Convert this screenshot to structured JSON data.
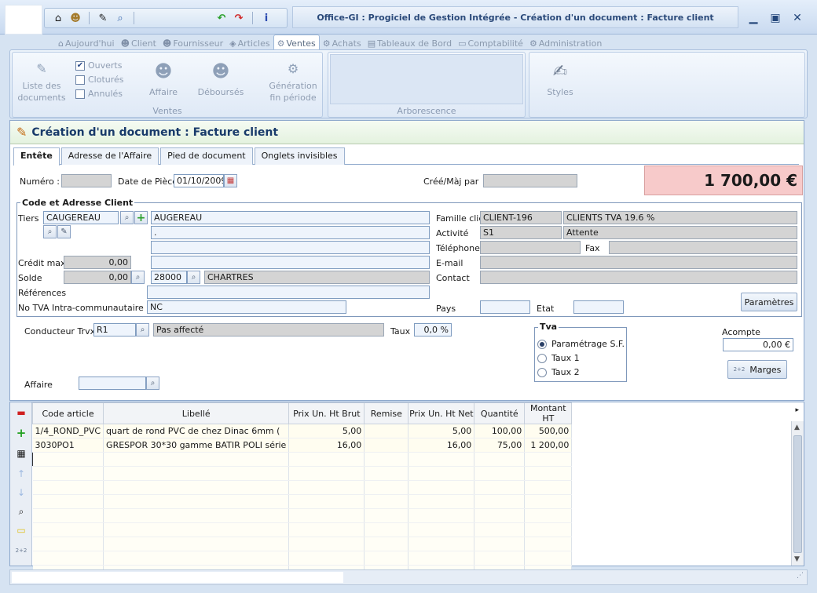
{
  "window": {
    "title": "Office-GI : Progiciel de Gestion Intégrée - Création d'un document : Facture client"
  },
  "ribbon_tabs": [
    {
      "label": "Aujourd'hui",
      "icon": "home-icon"
    },
    {
      "label": "Client",
      "icon": "person-icon"
    },
    {
      "label": "Fournisseur",
      "icon": "person-icon"
    },
    {
      "label": "Articles",
      "icon": "box-icon"
    },
    {
      "label": "Ventes",
      "icon": "gear-icon"
    },
    {
      "label": "Achats",
      "icon": "cart-icon"
    },
    {
      "label": "Tableaux de Bord",
      "icon": "chart-icon"
    },
    {
      "label": "Comptabilité",
      "icon": "calculator-icon"
    },
    {
      "label": "Administration",
      "icon": "gear-icon"
    }
  ],
  "ribbon": {
    "ventes_group": {
      "label": "Ventes",
      "liste_docs": "Liste des\ndocuments",
      "filters": [
        {
          "label": "Ouverts",
          "checked": true
        },
        {
          "label": "Cloturés",
          "checked": false
        },
        {
          "label": "Annulés",
          "checked": false
        }
      ],
      "affaire": "Affaire",
      "debourses": "Déboursés",
      "generation": "Génération\nfin période"
    },
    "arborescence_label": "Arborescence",
    "styles_label": "Styles"
  },
  "doc": {
    "header_title": "Création d'un document : Facture client",
    "tabs": [
      "Entête",
      "Adresse de l'Affaire",
      "Pied de document",
      "Onglets invisibles"
    ],
    "numero_label": "Numéro :",
    "numero_value": "",
    "date_label": "Date de Pièce",
    "date_value": "01/10/2009",
    "cree_label": "Créé/Màj par",
    "cree_value": "",
    "total": "1 700,00 €",
    "client_section": "Code et Adresse Client",
    "tiers_label": "Tiers",
    "tiers_code": "CAUGEREAU",
    "tiers_name": "AUGEREAU",
    "addr1": ".",
    "addr2": "",
    "addr3": "",
    "credit_label": "Crédit max",
    "credit_value": "0,00",
    "solde_label": "Solde",
    "solde_value": "0,00",
    "cp_value": "28000",
    "ville_value": "CHARTRES",
    "references_label": "Références",
    "references_value": "",
    "tva_intra_label": "No TVA Intra-communautaire",
    "tva_intra_value": "NC",
    "famille_label": "Famille client",
    "famille_code": "CLIENT-196",
    "famille_name": "CLIENTS TVA 19.6 %",
    "activite_label": "Activité",
    "activite_code": "S1",
    "activite_name": "Attente",
    "telephone_label": "Téléphone",
    "fax_label": "Fax",
    "email_label": "E-mail",
    "contact_label": "Contact",
    "pays_label": "Pays",
    "etat_label": "Etat",
    "parametres_btn": "Paramètres",
    "conducteur_label": "Conducteur Trvx",
    "conducteur_code": "R1",
    "conducteur_name": "Pas affecté",
    "taux_label": "Taux",
    "taux_value": "0,0 %",
    "tva_group": "Tva",
    "tva_options": [
      {
        "label": "Paramétrage S.F.",
        "selected": true
      },
      {
        "label": "Taux 1",
        "selected": false
      },
      {
        "label": "Taux 2",
        "selected": false
      }
    ],
    "acompte_label": "Acompte",
    "acompte_value": "0,00 €",
    "marges_btn": "Marges",
    "marges_icon_text": "2+2",
    "affaire_label": "Affaire",
    "affaire_value": ""
  },
  "grid": {
    "columns": [
      "Code article",
      "Libellé",
      "Prix Un. Ht Brut",
      "Remise",
      "Prix Un. Ht Net",
      "Quantité",
      "Montant HT"
    ],
    "rows": [
      [
        "1/4_ROND_PVC",
        "quart de rond PVC de chez Dinac 6mm (",
        "5,00",
        "",
        "5,00",
        "100,00",
        "500,00"
      ],
      [
        "3030PO1",
        "GRESPOR 30*30 gamme BATIR POLI série",
        "16,00",
        "",
        "16,00",
        "75,00",
        "1 200,00"
      ]
    ],
    "tools_text": "2+2"
  },
  "colors": {
    "total_bg": "#f7caca",
    "header_bg": "#e4f2df",
    "accent": "#2b4a7a"
  }
}
